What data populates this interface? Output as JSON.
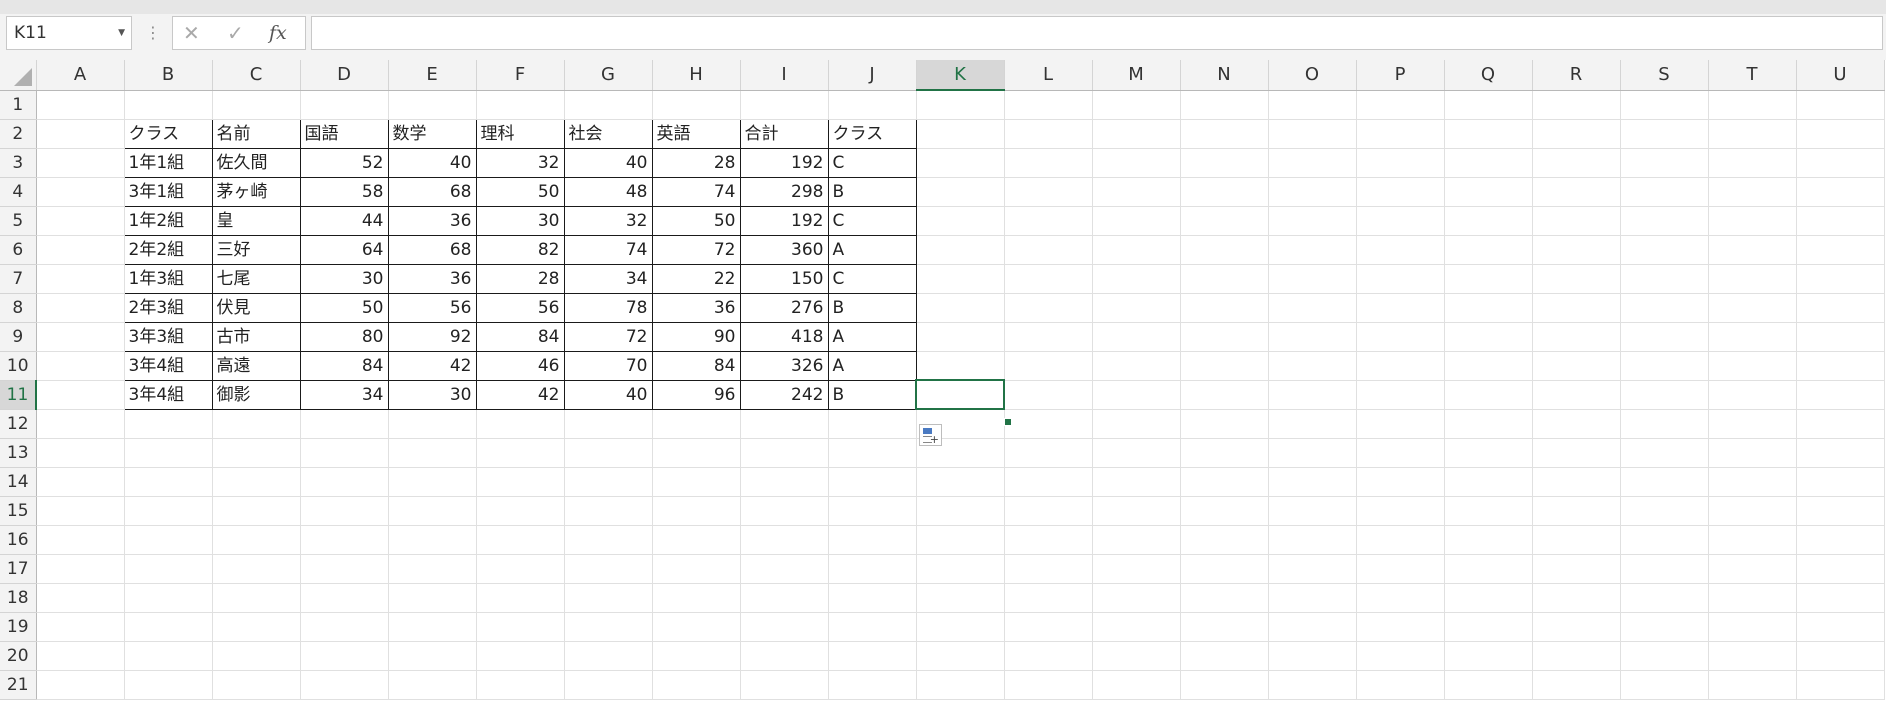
{
  "name_box": {
    "value": "K11"
  },
  "formula_bar": {
    "cancel_icon": "✕",
    "enter_icon": "✓",
    "fx_label": "fx",
    "formula_value": ""
  },
  "columns": [
    "A",
    "B",
    "C",
    "D",
    "E",
    "F",
    "G",
    "H",
    "I",
    "J",
    "K",
    "L",
    "M",
    "N",
    "O",
    "P",
    "Q",
    "R",
    "S",
    "T",
    "U"
  ],
  "rows": [
    "1",
    "2",
    "3",
    "4",
    "5",
    "6",
    "7",
    "8",
    "9",
    "10",
    "11",
    "12",
    "13",
    "14",
    "15",
    "16",
    "17",
    "18",
    "19",
    "20",
    "21"
  ],
  "table": {
    "headers": [
      "クラス",
      "名前",
      "国語",
      "数学",
      "理科",
      "社会",
      "英語",
      "合計",
      "クラス"
    ],
    "rows": [
      [
        "1年1組",
        "佐久間",
        "52",
        "40",
        "32",
        "40",
        "28",
        "192",
        "C"
      ],
      [
        "3年1組",
        "茅ヶ崎",
        "58",
        "68",
        "50",
        "48",
        "74",
        "298",
        "B"
      ],
      [
        "1年2組",
        "皇",
        "44",
        "36",
        "30",
        "32",
        "50",
        "192",
        "C"
      ],
      [
        "2年2組",
        "三好",
        "64",
        "68",
        "82",
        "74",
        "72",
        "360",
        "A"
      ],
      [
        "1年3組",
        "七尾",
        "30",
        "36",
        "28",
        "34",
        "22",
        "150",
        "C"
      ],
      [
        "2年3組",
        "伏見",
        "50",
        "56",
        "56",
        "78",
        "36",
        "276",
        "B"
      ],
      [
        "3年3組",
        "古市",
        "80",
        "92",
        "84",
        "72",
        "90",
        "418",
        "A"
      ],
      [
        "3年4組",
        "高遠",
        "84",
        "42",
        "46",
        "70",
        "84",
        "326",
        "A"
      ],
      [
        "3年4組",
        "御影",
        "34",
        "30",
        "42",
        "40",
        "96",
        "242",
        "B"
      ]
    ]
  },
  "active_cell": {
    "col": "K",
    "row": "11"
  },
  "icons": {
    "select_all": "select-all-triangle-icon",
    "quick_analysis": "quick-analysis-icon"
  },
  "colors": {
    "selection": "#217346",
    "header_bg": "#f3f3f3",
    "gridline": "#e0e0e0"
  }
}
